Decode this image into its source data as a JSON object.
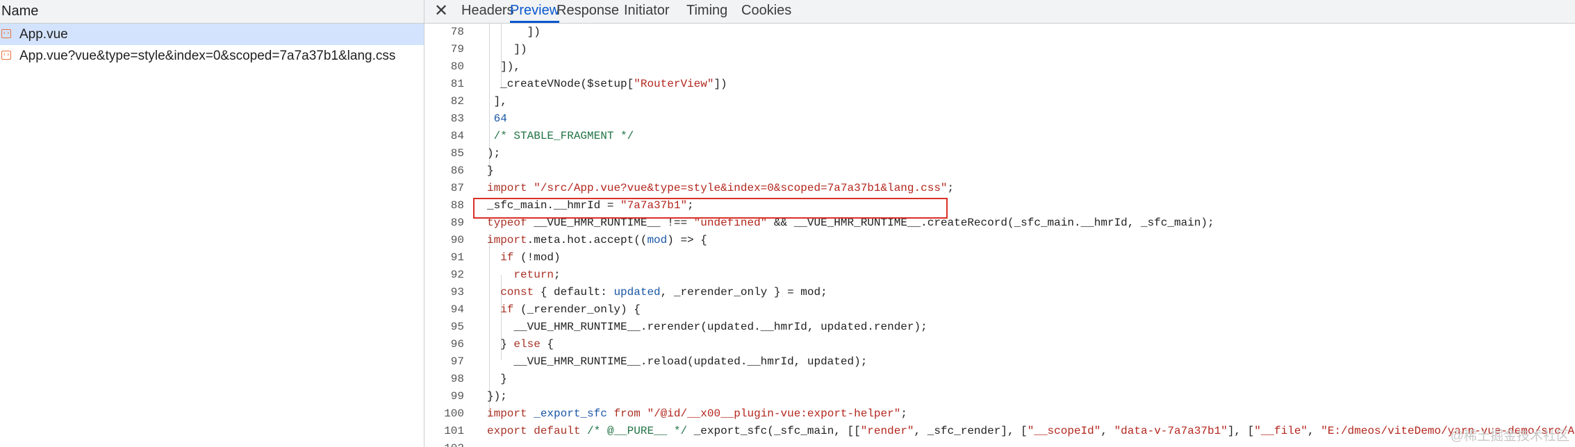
{
  "left_panel": {
    "header": "Name",
    "requests": [
      {
        "name": "App.vue",
        "selected": true,
        "icon": "vue-file-icon"
      },
      {
        "name": "App.vue?vue&type=style&index=0&scoped=7a7a37b1&lang.css",
        "selected": false,
        "icon": "vue-file-icon"
      }
    ]
  },
  "tabs": {
    "close_glyph": "✕",
    "items": [
      "Headers",
      "Preview",
      "Response",
      "Initiator",
      "Timing",
      "Cookies"
    ],
    "active": "Preview"
  },
  "code": {
    "lines": [
      {
        "n": "78",
        "html": "      ])"
      },
      {
        "n": "79",
        "html": "    ])"
      },
      {
        "n": "80",
        "html": "  ]),"
      },
      {
        "n": "81",
        "html": "  _createVNode($setup[<span class='str'>\"RouterView\"</span>])"
      },
      {
        "n": "82",
        "html": " ],"
      },
      {
        "n": "83",
        "html": " <span class='num'>64</span>"
      },
      {
        "n": "84",
        "html": " <span class='com'>/* STABLE_FRAGMENT */</span>"
      },
      {
        "n": "85",
        "html": ");"
      },
      {
        "n": "86",
        "html": "}"
      },
      {
        "n": "87",
        "html": "<span class='kw'>import</span> <span class='str'>\"/src/App.vue?vue&amp;type=style&amp;index=0&amp;scoped=7a7a37b1&amp;lang.css\"</span>;"
      },
      {
        "n": "88",
        "html": "_sfc_main.__hmrId = <span class='str'>\"7a7a37b1\"</span>;"
      },
      {
        "n": "89",
        "html": "<span class='kw'>typeof</span> __VUE_HMR_RUNTIME__ !== <span class='str'>\"undefined\"</span> &amp;&amp; __VUE_HMR_RUNTIME__.createRecord(_sfc_main.__hmrId, _sfc_main);"
      },
      {
        "n": "90",
        "html": "<span class='kw'>import</span>.meta.hot.accept((<span class='var'>mod</span>) =&gt; {"
      },
      {
        "n": "91",
        "html": "  <span class='kw'>if</span> (!mod)"
      },
      {
        "n": "92",
        "html": "    <span class='kw'>return</span>;"
      },
      {
        "n": "93",
        "html": "  <span class='kw'>const</span> { default: <span class='var'>updated</span>, _rerender_only } = mod;"
      },
      {
        "n": "94",
        "html": "  <span class='kw'>if</span> (_rerender_only) {"
      },
      {
        "n": "95",
        "html": "    __VUE_HMR_RUNTIME__.rerender(updated.__hmrId, updated.render);"
      },
      {
        "n": "96",
        "html": "  } <span class='kw'>else</span> {"
      },
      {
        "n": "97",
        "html": "    __VUE_HMR_RUNTIME__.reload(updated.__hmrId, updated);"
      },
      {
        "n": "98",
        "html": "  }"
      },
      {
        "n": "99",
        "html": "});"
      },
      {
        "n": "100",
        "html": "<span class='kw'>import</span> <span class='var'>_export_sfc</span> <span class='kw'>from</span> <span class='str'>\"/@id/__x00__plugin-vue:export-helper\"</span>;"
      },
      {
        "n": "101",
        "html": "<span class='kw'>export default</span> <span class='com'>/* @__PURE__ */</span> _export_sfc(_sfc_main, [[<span class='str'>\"render\"</span>, _sfc_render], [<span class='str'>\"__scopeId\"</span>, <span class='str'>\"data-v-7a7a37b1\"</span>], [<span class='str'>\"__file\"</span>, <span class='str'>\"E:/dmeos/viteDemo/yarn-vue-demo/src/App.vue\"</span>]]);"
      },
      {
        "n": "102",
        "html": ""
      }
    ]
  },
  "watermark": "@稀土掘金技术社区",
  "colors": {
    "accent": "#0b57d0",
    "highlight_box": "#d93025",
    "selected_row": "#d3e3fd"
  }
}
